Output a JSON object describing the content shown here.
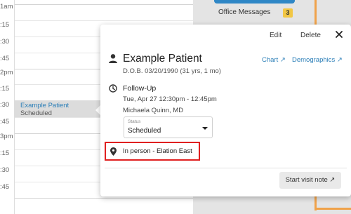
{
  "calendar": {
    "time_labels": [
      "1am",
      ":15",
      ":30",
      ":45",
      "2pm",
      ":15",
      ":30",
      ":45",
      "3pm",
      ":15",
      ":30",
      ":45"
    ],
    "event": {
      "patient_name": "Example Patient",
      "status": "Scheduled",
      "highlight_color": "#dcdcdc"
    }
  },
  "right_panel": {
    "office_messages_label": "Office Messages",
    "office_messages_count": "3",
    "badge_color": "#f2c744",
    "accent_color": "#f0a24a"
  },
  "popup": {
    "header": {
      "edit_label": "Edit",
      "delete_label": "Delete",
      "close_label": "✕"
    },
    "patient": {
      "icon": "person-icon",
      "name": "Example Patient",
      "dob": "D.O.B. 03/20/1990 (31 yrs, 1 mo)",
      "chart_link": "Chart ↗",
      "demographics_link": "Demographics ↗",
      "link_color": "#2c7fb8"
    },
    "appointment": {
      "icon": "clock-icon",
      "type": "Follow-Up",
      "time": "Tue, Apr 27  12:30pm - 12:45pm",
      "provider": "Michaela Quinn, MD",
      "status_field": {
        "label": "Status",
        "value": "Scheduled"
      }
    },
    "location": {
      "icon": "map-pin-icon",
      "text": "In person - Elation East",
      "highlight_color": "#e02020"
    },
    "start_visit_note_label": "Start visit note ↗"
  }
}
